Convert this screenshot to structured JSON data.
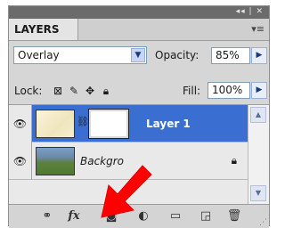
{
  "window": {
    "controls_label": "◂◂ | ✕"
  },
  "panel": {
    "tab_label": "LAYERS",
    "menu_icon": "panel-menu-icon"
  },
  "blend": {
    "mode": "Overlay",
    "opacity_label": "Opacity:",
    "opacity_value": "85%"
  },
  "locks": {
    "label": "Lock:",
    "fill_label": "Fill:",
    "fill_value": "100%"
  },
  "layers": [
    {
      "name": "Layer 1",
      "selected": true
    },
    {
      "name": "Backgro",
      "selected": false
    }
  ],
  "bottom_icons": [
    "link-layers-icon",
    "fx-layer-style-icon",
    "add-layer-mask-icon",
    "adjustment-layer-icon",
    "new-group-icon",
    "new-layer-icon",
    "delete-layer-icon"
  ],
  "fx_label": "fx",
  "colors": {
    "selection": "#3a6fd1",
    "annotation_arrow": "#ff0000"
  }
}
